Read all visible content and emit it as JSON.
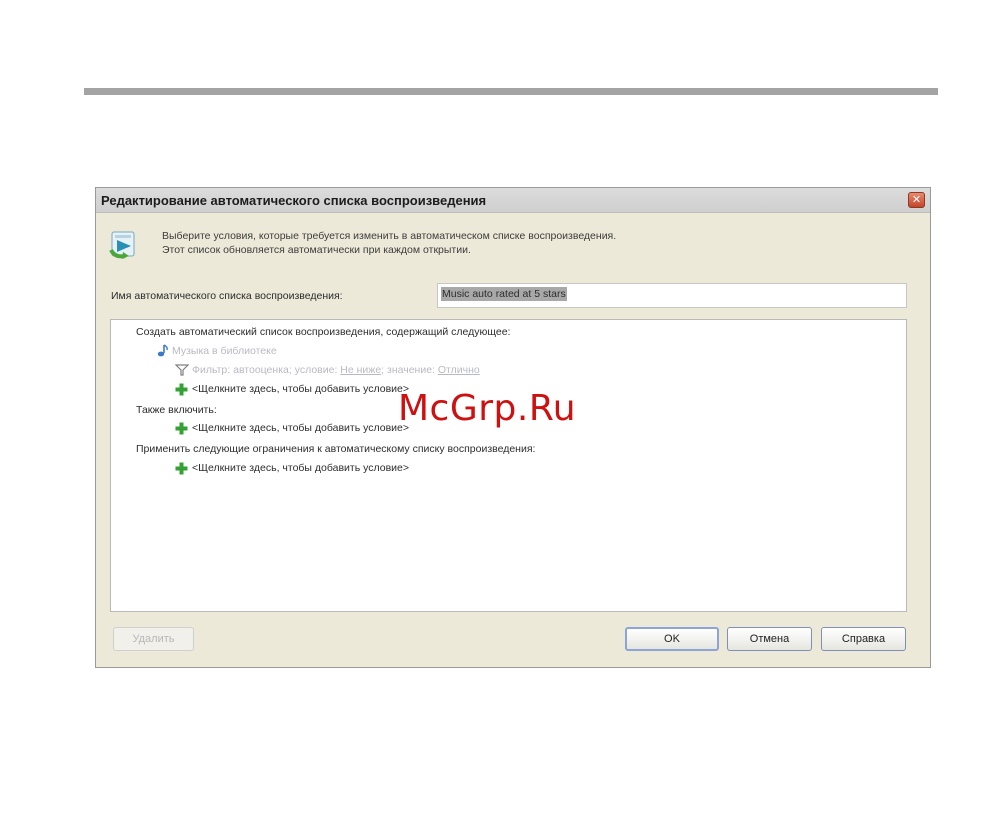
{
  "watermark": "McGrp.Ru",
  "dialog": {
    "title": "Редактирование автоматического списка воспроизведения",
    "description": [
      "Выберите условия, которые требуется изменить в автоматическом списке воспроизведения.",
      "Этот список обновляется автоматически при каждом открытии."
    ],
    "name_label": "Имя автоматического списка воспроизведения:",
    "name_value": "Music auto rated at 5 stars",
    "tree": {
      "create_header": "Создать автоматический список воспроизведения, содержащий следующее:",
      "music_in_library": "Музыка в библиотеке",
      "filter": {
        "prefix": "Фильтр: автооценка; условие:",
        "condition": "Не ниже",
        "value_prefix": "; значение:",
        "value": "Отлично"
      },
      "add_condition_1": "<Щелкните здесь, чтобы добавить условие>",
      "also_include": "Также включить:",
      "add_condition_2": "<Щелкните здесь, чтобы добавить условие>",
      "restrictions_header": "Применить следующие ограничения к автоматическому списку воспроизведения:",
      "add_condition_3": "<Щелкните здесь, чтобы добавить условие>"
    },
    "buttons": {
      "delete": "Удалить",
      "ok": "OK",
      "cancel": "Отмена",
      "help": "Справка"
    },
    "close_glyph": "✕"
  }
}
